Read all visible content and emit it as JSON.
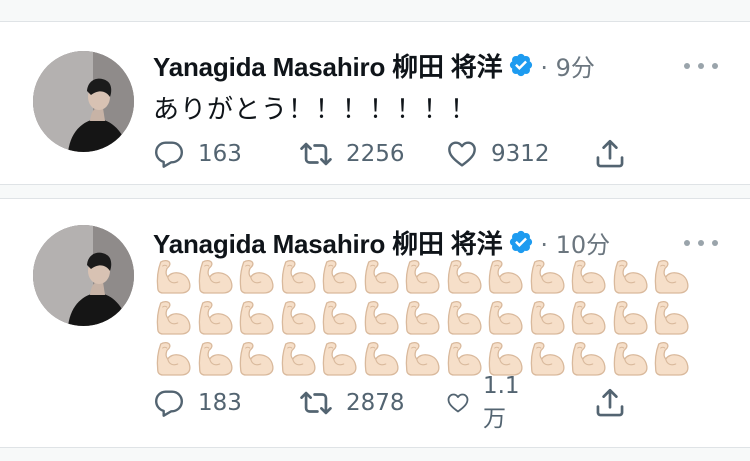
{
  "colors": {
    "text": "#0f1419",
    "muted": "#536471",
    "verified": "#1d9bf0",
    "divider": "#dfe3e6"
  },
  "tweets": [
    {
      "author": "Yanagida Masahiro 柳田 将洋",
      "time": "· 9分",
      "text": "ありがとう！！！！！！！",
      "emoji_rows": 0,
      "emoji_per_row": 0,
      "replies": "163",
      "retweets": "2256",
      "likes": "9312"
    },
    {
      "author": "Yanagida Masahiro 柳田 将洋",
      "time": "· 10分",
      "text": "",
      "emoji_name": "flexed-biceps",
      "emoji_rows": 3,
      "emoji_per_row": 13,
      "replies": "183",
      "retweets": "2878",
      "likes": "1.1万"
    }
  ],
  "icons": [
    "reply-icon",
    "retweet-icon",
    "like-icon",
    "share-icon",
    "verified-badge-icon",
    "more-icon"
  ]
}
